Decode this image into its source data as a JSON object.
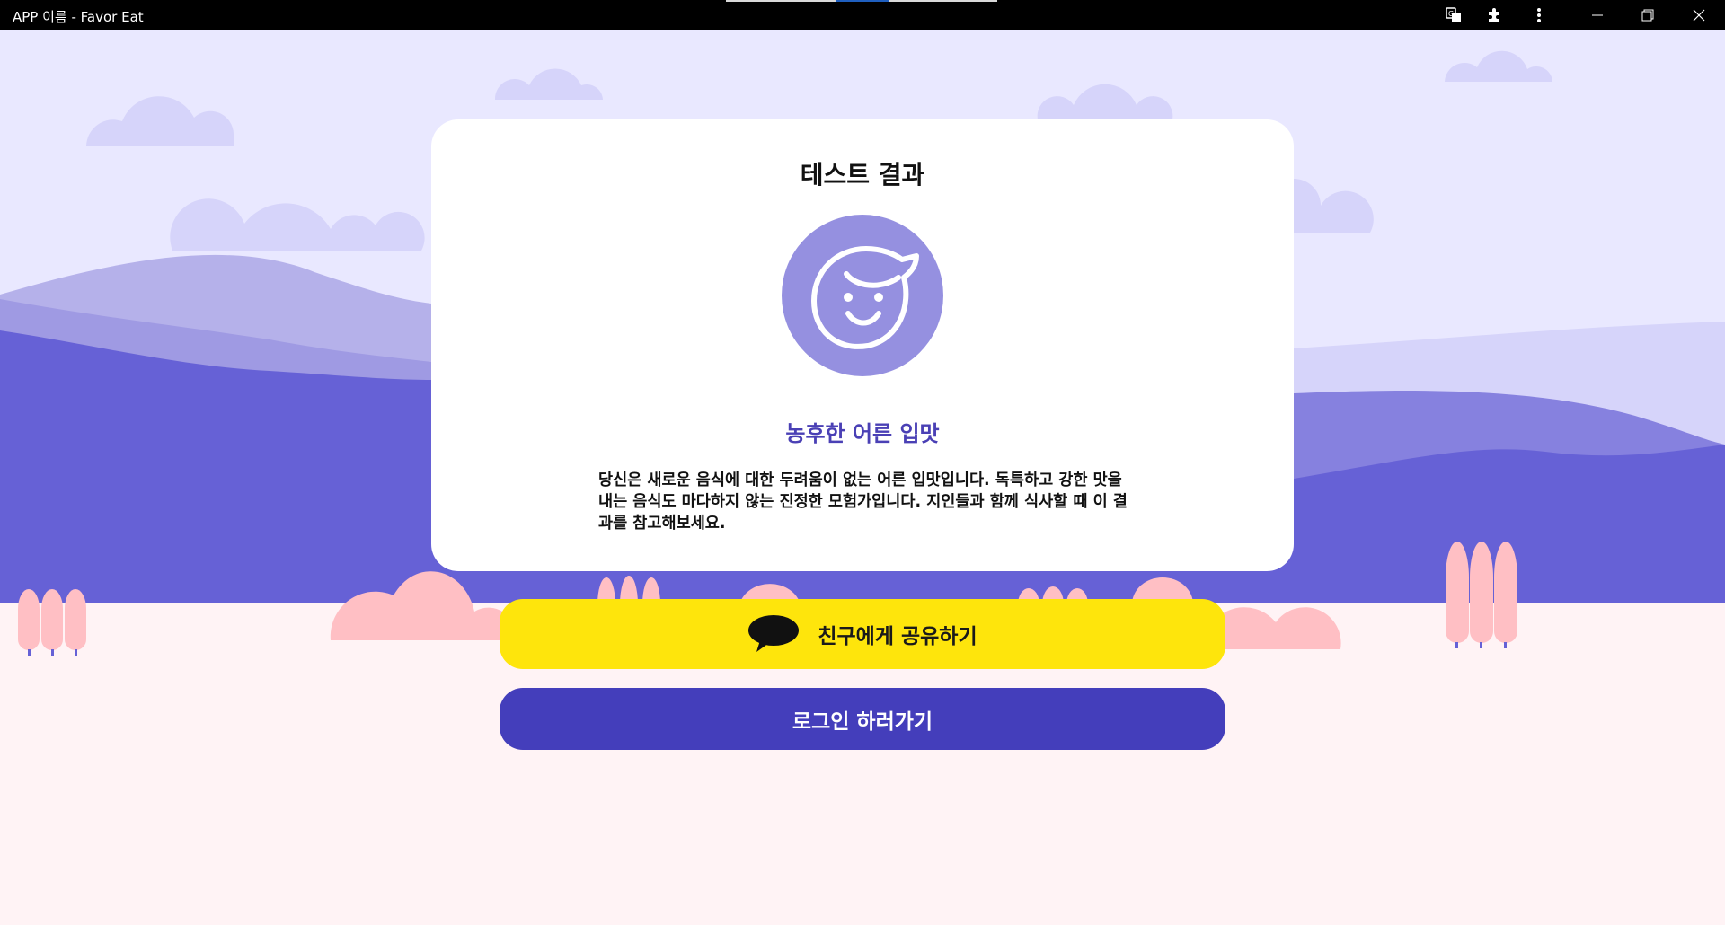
{
  "window": {
    "title": "APP 이름 - Favor Eat",
    "controls": {
      "translate_icon": "translate-icon",
      "extensions_icon": "puzzle-icon",
      "menu_icon": "kebab-menu-icon",
      "minimize_icon": "minimize-icon",
      "restore_icon": "restore-icon",
      "close_icon": "close-icon"
    }
  },
  "result_card": {
    "title": "테스트 결과",
    "avatar_icon": "smiling-face-icon",
    "result_name": "농후한 어른 입맛",
    "description": "당신은 새로운 음식에 대한 두려움이 없는 어른 입맛입니다. 독특하고 강한 맛을 내는 음식도 마다하지 않는 진정한 모험가입니다. 지인들과 함께 식사할 때 이 결과를 참고해보세요."
  },
  "actions": {
    "share_label": "친구에게 공유하기",
    "share_icon": "kakao-speech-bubble-icon",
    "login_label": "로그인 하러가기"
  },
  "colors": {
    "accent": "#443ebb",
    "kakao_yellow": "#fee50c",
    "avatar_bg": "#9590e0",
    "sky": "#e9e8ff",
    "ground": "#fff3f5"
  }
}
